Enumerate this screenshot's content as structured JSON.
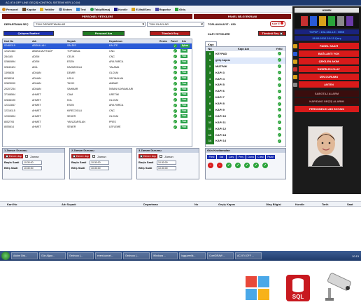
{
  "window_title": "AC-974 OFF LINE GEÇİŞ KONTROL SİSTEMİ VER.1.0.0.6",
  "menu": [
    "Personel",
    "Kapılar",
    "Yetkiler",
    "Sistem",
    "Test",
    "Takip/Masaj",
    "Kontör",
    "E-Mail/Sms",
    "Raporlar",
    "Giriş"
  ],
  "headers": {
    "personel": "PERSONEL YETKİLERİ",
    "panel": "PANEL BİLGİ EKRANI"
  },
  "filters": {
    "departman_label": "DEPARTMAN SEÇ",
    "departman_value": "TÜM DEPARTMANLAR",
    "olaylar_value": "TÜM OLAYLAR",
    "toplam_label": "TOPLAM KAYIT : 650",
    "kayit_label": "KAYIT",
    "kapi_yetkileri": "KAPI YETKİLERİ",
    "tumunu_sec_right": "Tümünü Seç"
  },
  "buttons": {
    "calisma": "Çalışma Saatleri",
    "personel_ara": "Personel Ara",
    "tumunu_sec": "Tümünü Seç"
  },
  "employee_table": {
    "columns": [
      "Kart No",
      "Adı",
      "Soyadı",
      "Departman",
      "Resim",
      "Panel",
      "İzin"
    ],
    "rows": [
      [
        "02460119",
        "ABDULLAH",
        "SALDIS",
        "KALİTE",
        "",
        "",
        "Yok"
      ],
      [
        "12321463",
        "ABDULMUTTALİP",
        "TOPSAKAL",
        "CNC",
        "",
        "",
        "Yok"
      ],
      [
        "284165",
        "ADEM",
        "CELİK",
        "CNC",
        "",
        "",
        "Yok"
      ],
      [
        "02860894",
        "ADEM",
        "ESEN",
        "ARA PARCA",
        "",
        "",
        "Yok"
      ],
      [
        "02842424",
        "ADİL",
        "KAZIMOGLU",
        "YALAMA",
        "",
        "",
        "Yok"
      ],
      [
        "1395835",
        "ADNAN",
        "DEMİR",
        "OLCUM",
        "",
        "",
        "Yok"
      ],
      [
        "8038518",
        "ADNAN",
        "USLU",
        "SATINALMA",
        "",
        "",
        "Yok"
      ],
      [
        "02825090",
        "ADNAN",
        "TASCI",
        "AMBAR",
        "",
        "",
        "Yok"
      ],
      [
        "20207254",
        "ADNAN",
        "SAHMAR",
        "İNSAN KAYNAKLARI",
        "",
        "",
        "Yok"
      ],
      [
        "37168564",
        "AHMET",
        "CAM",
        "URETİM",
        "",
        "",
        "Yok"
      ],
      [
        "02836190",
        "AHMET",
        "KOL",
        "OLCUM",
        "",
        "",
        "Yok"
      ],
      [
        "12312847",
        "AHMET",
        "ESEN",
        "ARA PARCA",
        "",
        "",
        "Yok"
      ],
      [
        "12316115",
        "AHMET",
        "KIRECOGLU",
        "CNC",
        "",
        "",
        "Yok"
      ],
      [
        "12302894",
        "AHMET",
        "SEKER",
        "OLCUM",
        "",
        "",
        "Yok"
      ],
      [
        "8052793",
        "AHMET",
        "YAVUZARSLAN",
        "PRES",
        "",
        "",
        "Yok"
      ],
      [
        "8055614",
        "AHMET",
        "SENER",
        "LEFLEME",
        "",
        "",
        "Yok"
      ]
    ],
    "first_izin_header_cell": "İşlem"
  },
  "kapi_table": {
    "tab": "Kapı",
    "columns": [
      "No",
      "Kapı Adı",
      "Yetki"
    ],
    "rows": [
      [
        "0",
        "KEYPAD"
      ],
      [
        "1",
        "giriş kapısı"
      ],
      [
        "2",
        "MUTFAK"
      ],
      [
        "3",
        "KAPI 3"
      ],
      [
        "4",
        "KAPI 4"
      ],
      [
        "5",
        "KAPI 5"
      ],
      [
        "6",
        "KAPI 6"
      ],
      [
        "7",
        "KAPI 7"
      ],
      [
        "8",
        "KAPI 8"
      ],
      [
        "9",
        "KAPI 9"
      ],
      [
        "10",
        "KAPI 10"
      ],
      [
        "11",
        "KAPI 11"
      ],
      [
        "12",
        "KAPI 12"
      ],
      [
        "13",
        "KAPI 13"
      ],
      [
        "14",
        "KAPI 14"
      ]
    ]
  },
  "zaman_boxes": [
    {
      "title": "1.Zaman Durumu",
      "devre": "Devre dışı",
      "zaman": "Zaman",
      "baslama": "Başla Saati",
      "bitis": "Bitiş Saati",
      "t1": "10:30:00",
      "t2": "10:30:00"
    },
    {
      "title": "2.Zaman Durumu",
      "devre": "Devre dışı",
      "zaman": "Zaman",
      "baslama": "Başla Saati",
      "bitis": "Bitiş Saati",
      "t1": "10:30:00",
      "t2": "10:30:00"
    },
    {
      "title": "3.Zaman Durumu",
      "devre": "Devre dışı",
      "zaman": "Zaman",
      "baslama": "Başla Saati",
      "bitis": "Bitiş Saati",
      "t1": "10:30:00",
      "t2": "10:30:00"
    }
  ],
  "gun": {
    "title": "Gün Kısıtlamaları",
    "days": [
      "P.tesi",
      "Salı",
      "Çarş",
      "Perş",
      "Cuma",
      "C.tesi",
      "Pazar"
    ]
  },
  "log_columns": [
    "Kart No",
    "Adı Soyadı",
    "Departman",
    "No",
    "Geçiş Kapısı",
    "Olay Bilgisi",
    "Kontör",
    "Tarih",
    "Saat"
  ],
  "right_panel": {
    "admin": "ADMİN",
    "ip": "TCP/IP : 192.168.1.5 : 5555",
    "date": "28.09.2016 10:13 Çarş",
    "buttons": [
      "PANEL SAATİ",
      "BAĞLANTI YOK",
      "ÇEKİLEN AKIM",
      "İNDİRİLEN OLAY",
      "İZİN DURUMU",
      "ANTEN",
      "SABOTAJ ALARM",
      "KAPIDAKİ GEÇİŞ ALARMI",
      "PERSONELİN ADI SOYADI"
    ]
  },
  "taskbar": [
    "Adobe Dist...",
    "Gün Ağacı...",
    "Gechooo (...",
    "event.cancel...",
    "Gechooo (...",
    "Windows ...",
    "logguvenlik...",
    "CorelDRAW ...",
    "AC-974 OFF ..."
  ],
  "clock": "10:13",
  "bottom_icons": [
    "windows-icon",
    "sql-icon",
    "security-camera-icon"
  ],
  "sql_label": "SQL"
}
